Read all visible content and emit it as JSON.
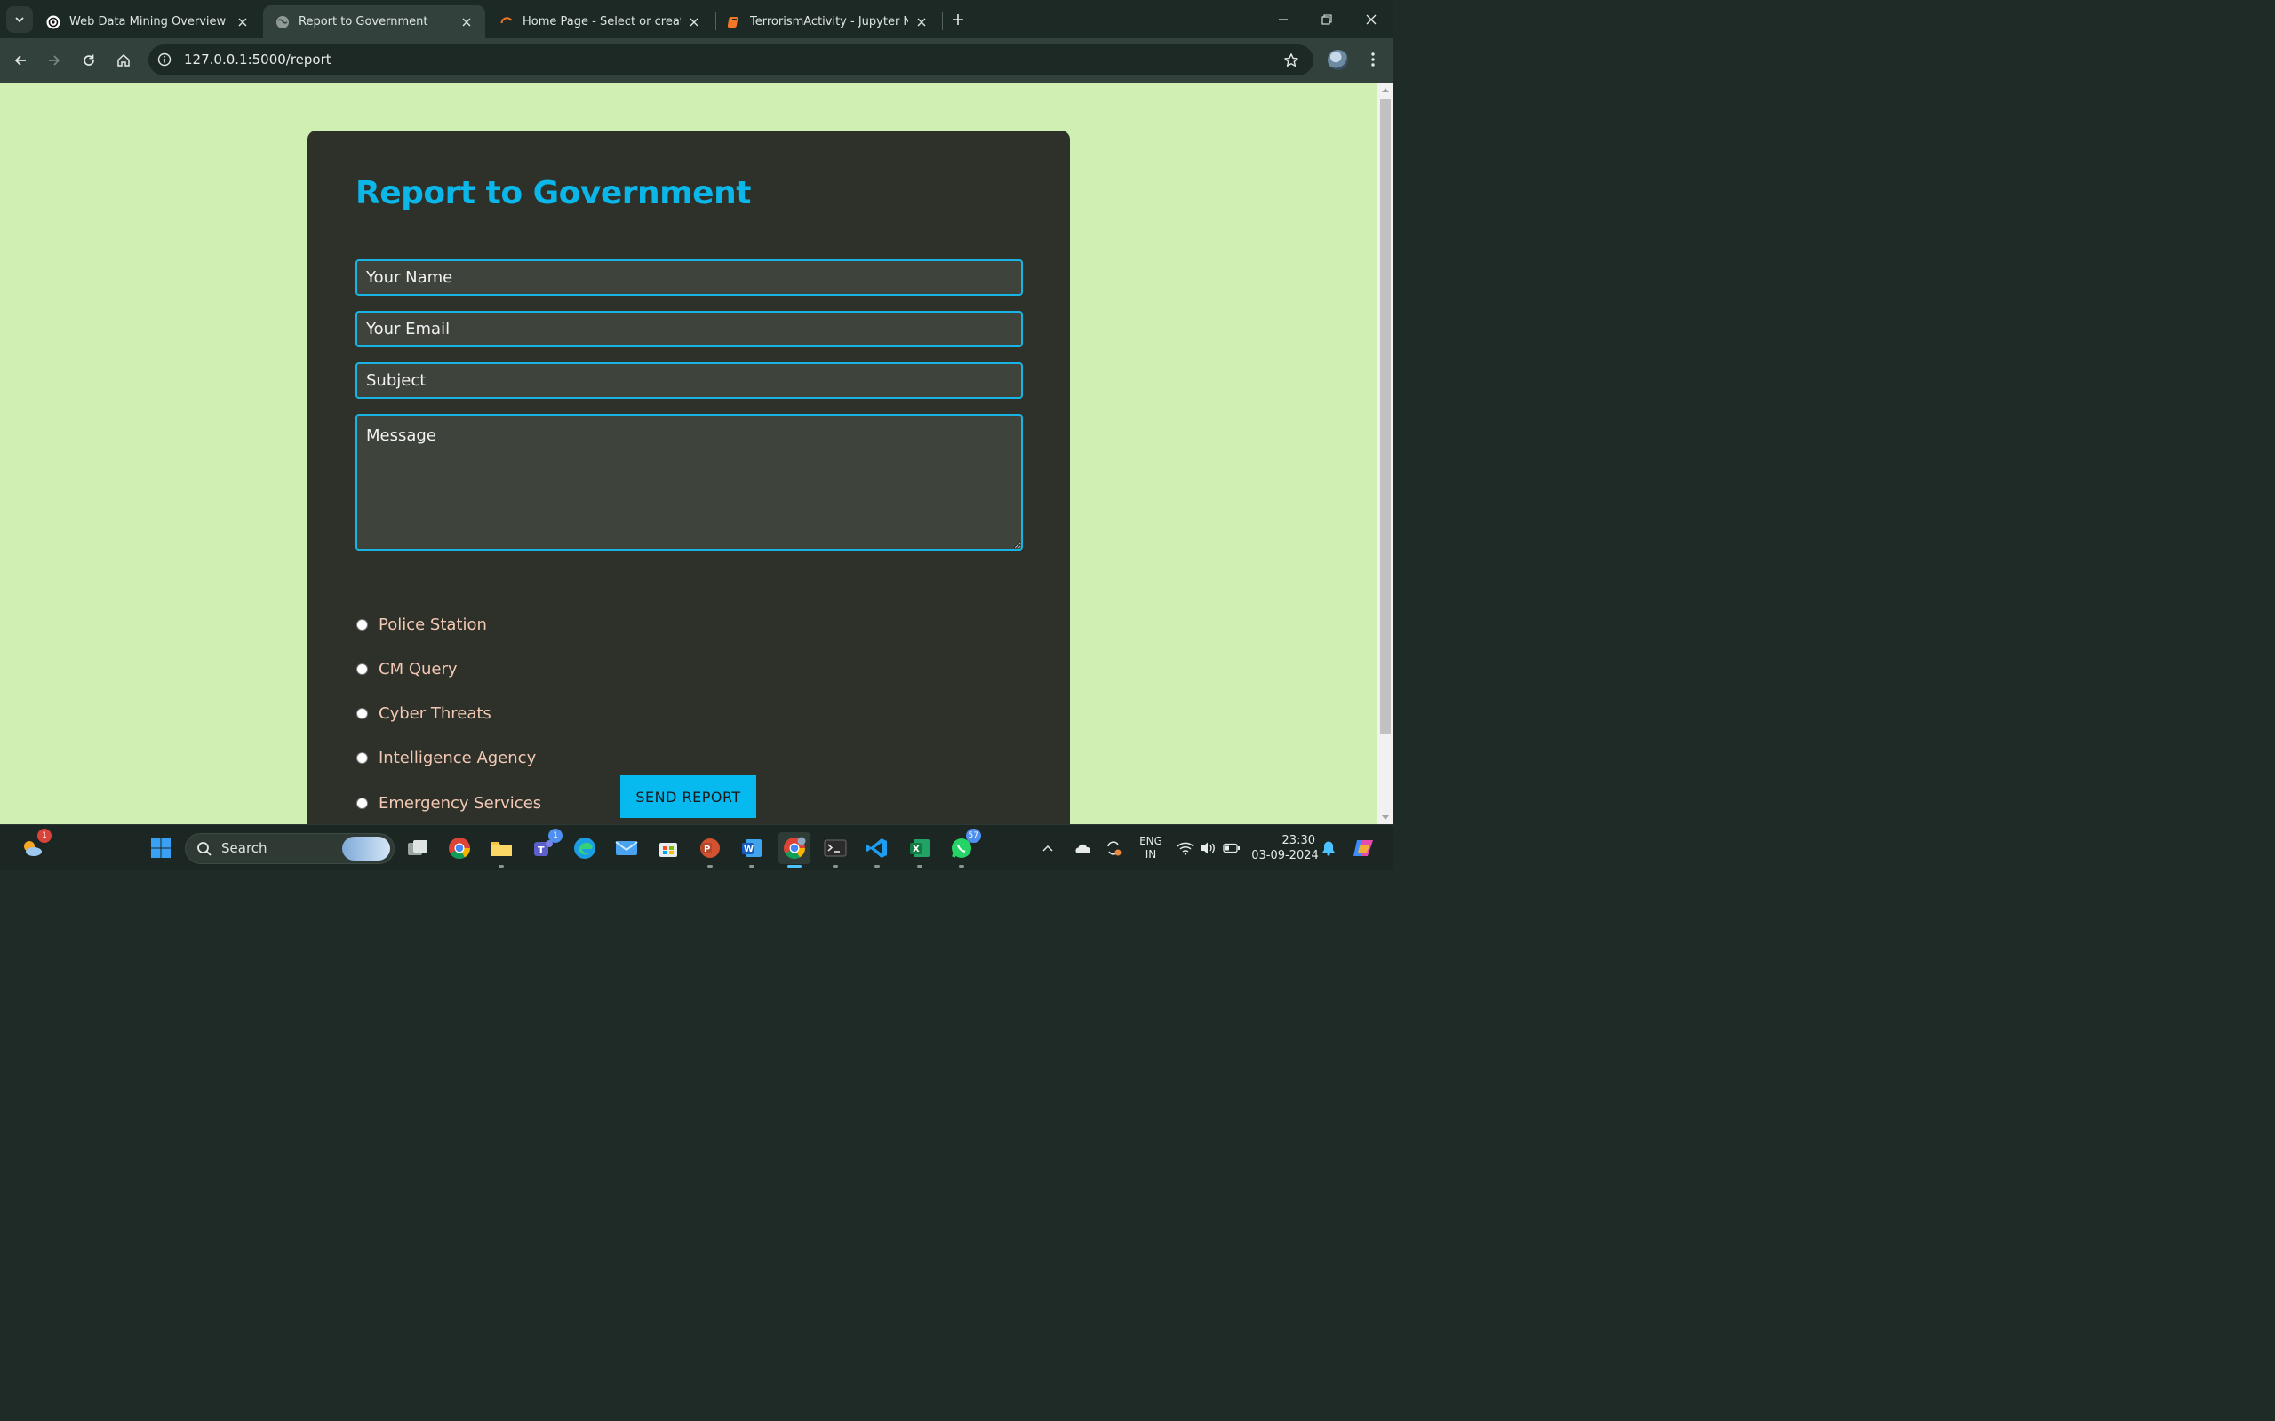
{
  "browser": {
    "tabs": [
      {
        "title": "Web Data Mining Overview",
        "favicon": "chatgpt-icon",
        "active": false
      },
      {
        "title": "Report to Government",
        "favicon": "globe-icon",
        "active": true
      },
      {
        "title": "Home Page - Select or create a",
        "favicon": "jupyter-loading-icon",
        "active": false
      },
      {
        "title": "TerrorismActivity - Jupyter Note",
        "favicon": "jupyter-notebook-icon",
        "active": false
      }
    ],
    "url": "127.0.0.1:5000/report"
  },
  "page": {
    "heading": "Report to Government",
    "name_placeholder": "Your Name",
    "email_placeholder": "Your Email",
    "subject_placeholder": "Subject",
    "message_placeholder": "Message",
    "options": [
      "Police Station",
      "CM Query",
      "Cyber Threats",
      "Intelligence Agency",
      "Emergency Services"
    ],
    "submit_label": "SEND REPORT",
    "colors": {
      "background": "#d0f0b3",
      "card": "#2d3129",
      "accent": "#0bb6e8",
      "option_text": "#f3c9b5"
    }
  },
  "taskbar": {
    "search_label": "Search",
    "weather_badge": "1",
    "teams_badge": "1",
    "whatsapp_badge": "57",
    "language": "ENG",
    "region": "IN",
    "time": "23:30",
    "date": "03-09-2024"
  }
}
